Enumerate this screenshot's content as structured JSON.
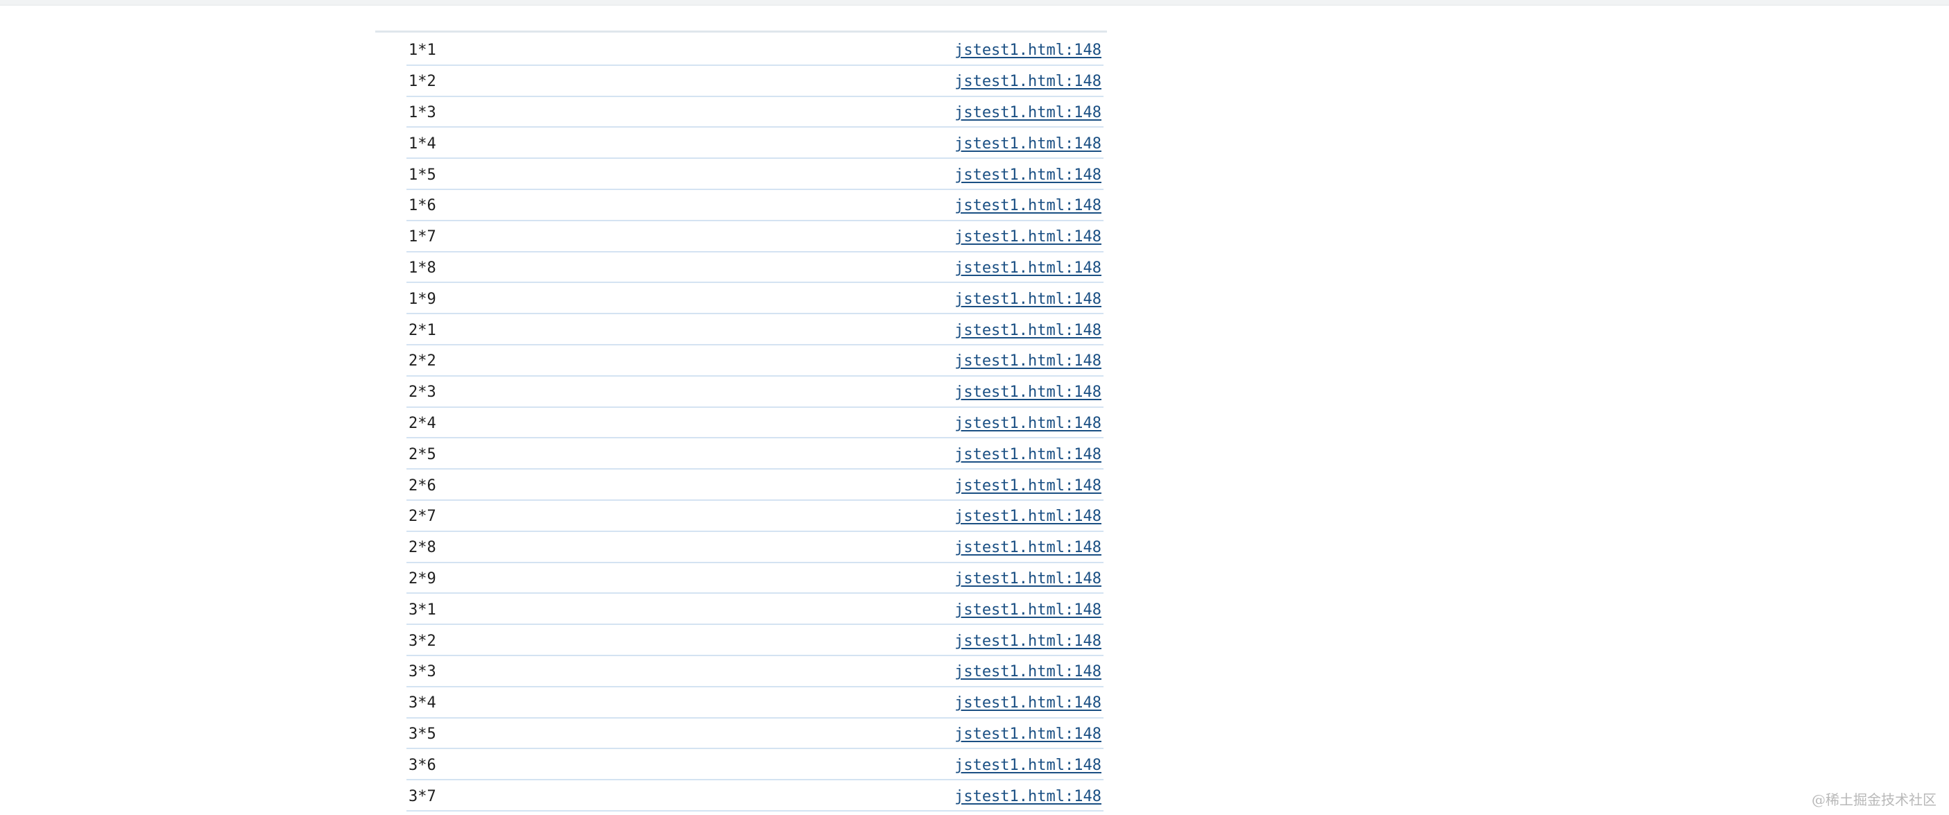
{
  "console": {
    "rows": [
      {
        "message": "1*1",
        "source": "jstest1.html:148"
      },
      {
        "message": "1*2",
        "source": "jstest1.html:148"
      },
      {
        "message": "1*3",
        "source": "jstest1.html:148"
      },
      {
        "message": "1*4",
        "source": "jstest1.html:148"
      },
      {
        "message": "1*5",
        "source": "jstest1.html:148"
      },
      {
        "message": "1*6",
        "source": "jstest1.html:148"
      },
      {
        "message": "1*7",
        "source": "jstest1.html:148"
      },
      {
        "message": "1*8",
        "source": "jstest1.html:148"
      },
      {
        "message": "1*9",
        "source": "jstest1.html:148"
      },
      {
        "message": "2*1",
        "source": "jstest1.html:148"
      },
      {
        "message": "2*2",
        "source": "jstest1.html:148"
      },
      {
        "message": "2*3",
        "source": "jstest1.html:148"
      },
      {
        "message": "2*4",
        "source": "jstest1.html:148"
      },
      {
        "message": "2*5",
        "source": "jstest1.html:148"
      },
      {
        "message": "2*6",
        "source": "jstest1.html:148"
      },
      {
        "message": "2*7",
        "source": "jstest1.html:148"
      },
      {
        "message": "2*8",
        "source": "jstest1.html:148"
      },
      {
        "message": "2*9",
        "source": "jstest1.html:148"
      },
      {
        "message": "3*1",
        "source": "jstest1.html:148"
      },
      {
        "message": "3*2",
        "source": "jstest1.html:148"
      },
      {
        "message": "3*3",
        "source": "jstest1.html:148"
      },
      {
        "message": "3*4",
        "source": "jstest1.html:148"
      },
      {
        "message": "3*5",
        "source": "jstest1.html:148"
      },
      {
        "message": "3*6",
        "source": "jstest1.html:148"
      },
      {
        "message": "3*7",
        "source": "jstest1.html:148"
      }
    ]
  },
  "watermark": {
    "text": "@稀土掘金技术社区"
  },
  "colors": {
    "message_text": "#1f1f1f",
    "source_link": "#1a4f83",
    "row_divider": "#d4e3f2",
    "panel_border": "#dfe6ec",
    "background": "#ffffff"
  }
}
